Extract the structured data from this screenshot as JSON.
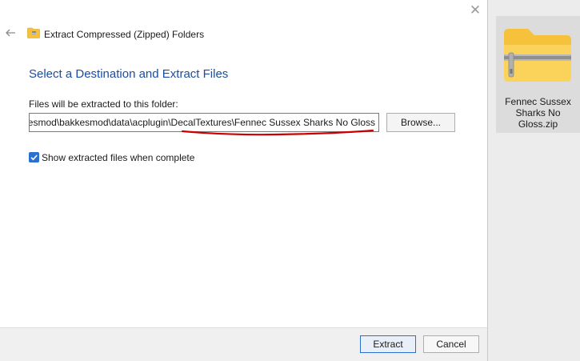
{
  "window": {
    "title": "Extract Compressed (Zipped) Folders",
    "close_glyph": "✕"
  },
  "main": {
    "heading": "Select a Destination and Extract Files",
    "path_label": "Files will be extracted to this folder:",
    "path_value": "esmod\\bakkesmod\\data\\acplugin\\DecalTextures\\Fennec Sussex Sharks No Gloss",
    "browse_label": "Browse...",
    "show_files_label": "Show extracted files when complete",
    "show_files_checked": true
  },
  "footer": {
    "extract_label": "Extract",
    "cancel_label": "Cancel"
  },
  "desktop": {
    "zip_file_name": "Fennec Sussex Sharks No Gloss.zip"
  },
  "colors": {
    "heading": "#1c4da3",
    "accent": "#2b6fcf",
    "annotation": "#cc0000",
    "folder": "#f6c23c"
  },
  "icons": {
    "back": "back-arrow-icon",
    "title": "zip-folder-icon",
    "checkbox": "checkmark-icon",
    "zip": "zip-folder-icon"
  }
}
